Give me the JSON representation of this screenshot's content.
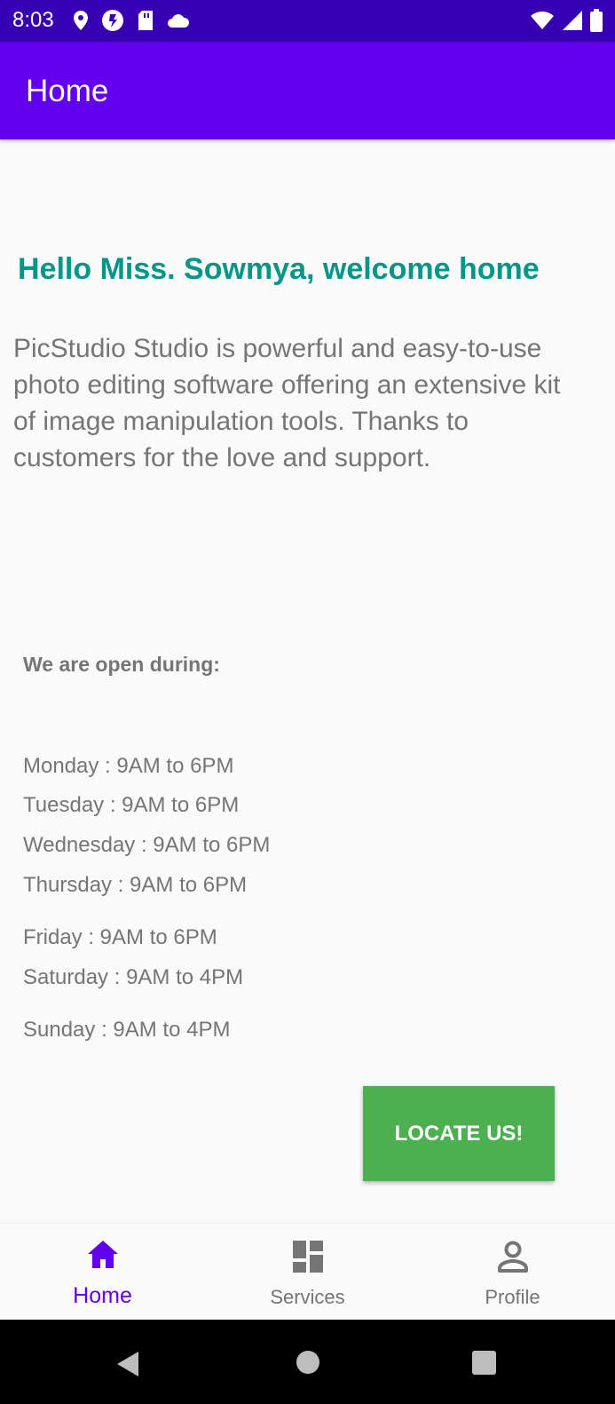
{
  "status_bar": {
    "time": "8:03",
    "icons_left": [
      "location-icon",
      "bolt-icon",
      "sd-card-icon",
      "cloud-icon"
    ],
    "icons_right": [
      "wifi-icon",
      "signal-icon",
      "battery-icon"
    ]
  },
  "app_bar": {
    "title": "Home"
  },
  "main": {
    "greeting": "Hello Miss. Sowmya, welcome home",
    "description": "PicStudio Studio is powerful and easy-to-use photo editing software offering an extensive kit of image manipulation tools. Thanks to customers for the love and support.",
    "hours_heading": "We are open during:",
    "hours": [
      "Monday : 9AM to 6PM",
      "Tuesday : 9AM to 6PM",
      "Wednesday : 9AM to 6PM",
      "Thursday : 9AM to 6PM",
      "Friday : 9AM to 6PM",
      "Saturday : 9AM to 4PM",
      "Sunday : 9AM to 4PM"
    ],
    "locate_button": "LOCATE US!"
  },
  "bottom_nav": {
    "items": [
      {
        "label": "Home",
        "icon": "home-icon",
        "active": true
      },
      {
        "label": "Services",
        "icon": "dashboard-icon",
        "active": false
      },
      {
        "label": "Profile",
        "icon": "person-icon",
        "active": false
      }
    ]
  },
  "colors": {
    "status_bar": "#3700b3",
    "app_bar": "#6200ee",
    "greeting": "#009688",
    "button": "#4caf50",
    "text_secondary": "#757575",
    "nav_active": "#6200ee"
  }
}
